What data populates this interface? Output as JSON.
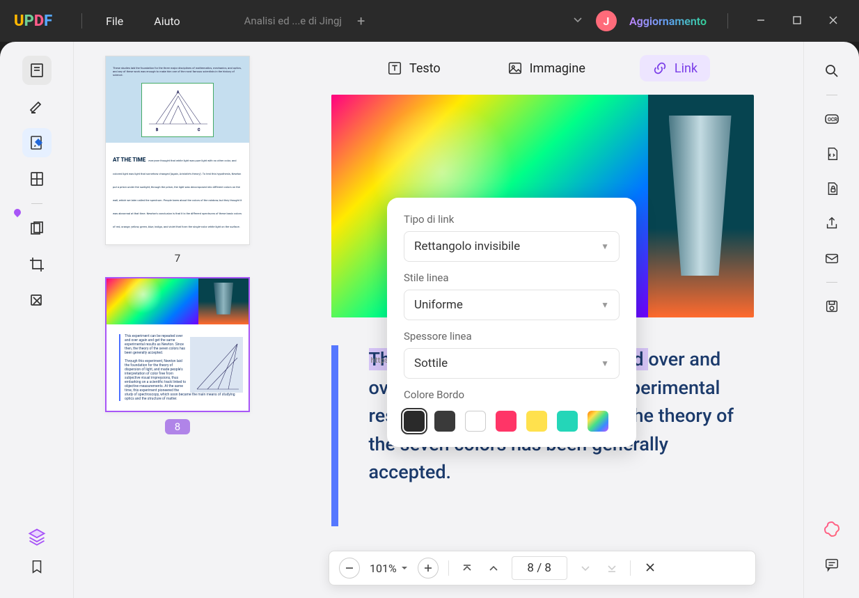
{
  "titlebar": {
    "logo": {
      "u": "U",
      "p": "P",
      "d": "D",
      "f": "F"
    },
    "menus": {
      "file": "File",
      "help": "Aiuto"
    },
    "tab": {
      "name": "Analisi ed ...e di Jingj",
      "add": "+"
    },
    "avatar_letter": "J",
    "update": "Aggiornamento"
  },
  "top_tabs": {
    "text": "Testo",
    "image": "Immagine",
    "link": "Link"
  },
  "thumbs": {
    "p7": {
      "label": "7",
      "top_text": "These studies laid the foundation for the three major disciplines of mathematics, mechanics, and optics, and any of these work was enough to make him one of the most famous scientists in the history of science.",
      "heading": "AT THE TIME",
      "body": "everyone thought that white light was pure light with no other color, and colored light was light that somehow changed (again, Aristotle's theory). To test this hypothesis, Newton put a prism under the sunlight; through the prism, the light was decomposed into different colors on the wall, which we later called the spectrum. People knew about the colors of the rainbow, but they thought it was abnormal at that time. Newton's conclusion is that it is the different spectrums of these basic colors of red, orange, yellow, green, blue, indigo, and violet that form the single-color white light on the surface."
    },
    "p8": {
      "label": "8",
      "para1": "This experiment can be repeated over and over again and get the same experimental results as Newton. Since then, the theory of the seven colors has been generally accepted.",
      "para2": "Through this experiment, Newton laid the foundation for the theory of dispersion of light, and made people's interpretation of color free from subjective visual impressions, thus embarking on a scientific track linked to objective measurements. At the same time, this experiment pioneered the study of spectroscopy, which soon became the main means of studying optics and the structure of matter."
    }
  },
  "doc": {
    "highlighted": "This experiment can be repeated",
    "rest": " over and over again and get the same experimental results as Newton. Since then, the theory of the seven colors has been generally accepted.",
    "link_overlay": "https://updf.com/create-pdf/edit-image-pdf/"
  },
  "popover": {
    "link_type_label": "Tipo di link",
    "link_type_value": "Rettangolo invisibile",
    "line_style_label": "Stile linea",
    "line_style_value": "Uniforme",
    "line_width_label": "Spessore linea",
    "line_width_value": "Sottile",
    "border_color_label": "Colore Bordo"
  },
  "bottom": {
    "zoom": "101%",
    "page_current": "8",
    "page_sep": "/",
    "page_total": "8"
  }
}
